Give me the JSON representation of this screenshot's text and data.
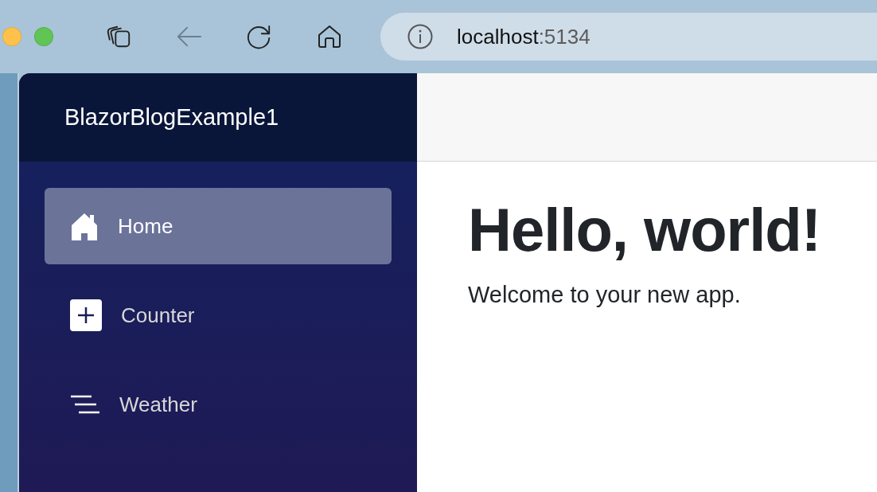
{
  "browser": {
    "address": {
      "host": "localhost",
      "port": ":5134"
    }
  },
  "sidebar": {
    "brand": "BlazorBlogExample1",
    "items": [
      {
        "label": "Home",
        "kind": "home",
        "selected": true
      },
      {
        "label": "Counter",
        "kind": "plus",
        "selected": false
      },
      {
        "label": "Weather",
        "kind": "lines",
        "selected": false
      }
    ]
  },
  "main": {
    "heading": "Hello, world!",
    "text": "Welcome to your new app."
  }
}
